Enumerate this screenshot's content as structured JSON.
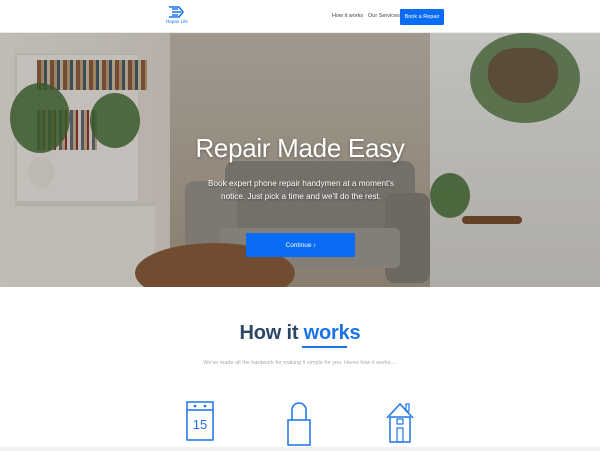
{
  "navbar": {
    "logo_text": "Repair Life",
    "links": [
      {
        "label": "How it works"
      },
      {
        "label": "Our Services"
      }
    ],
    "cta_label": "Book a Repair"
  },
  "hero": {
    "title": "Repair Made Easy",
    "subtitle": "Book expert phone repair handymen at a moment's notice. Just pick a time and we'll do the rest.",
    "button_label": "Continue ›"
  },
  "how_it_works": {
    "title_plain": "How it",
    "title_accent": "works",
    "subtitle": "We've made all the hardwork for making it simple for you. Heres how it works....",
    "calendar_number": "15",
    "icons": [
      "calendar-icon",
      "lock-icon",
      "house-icon"
    ]
  },
  "colors": {
    "accent": "#0a6cf5",
    "heading": "#2b4766"
  }
}
